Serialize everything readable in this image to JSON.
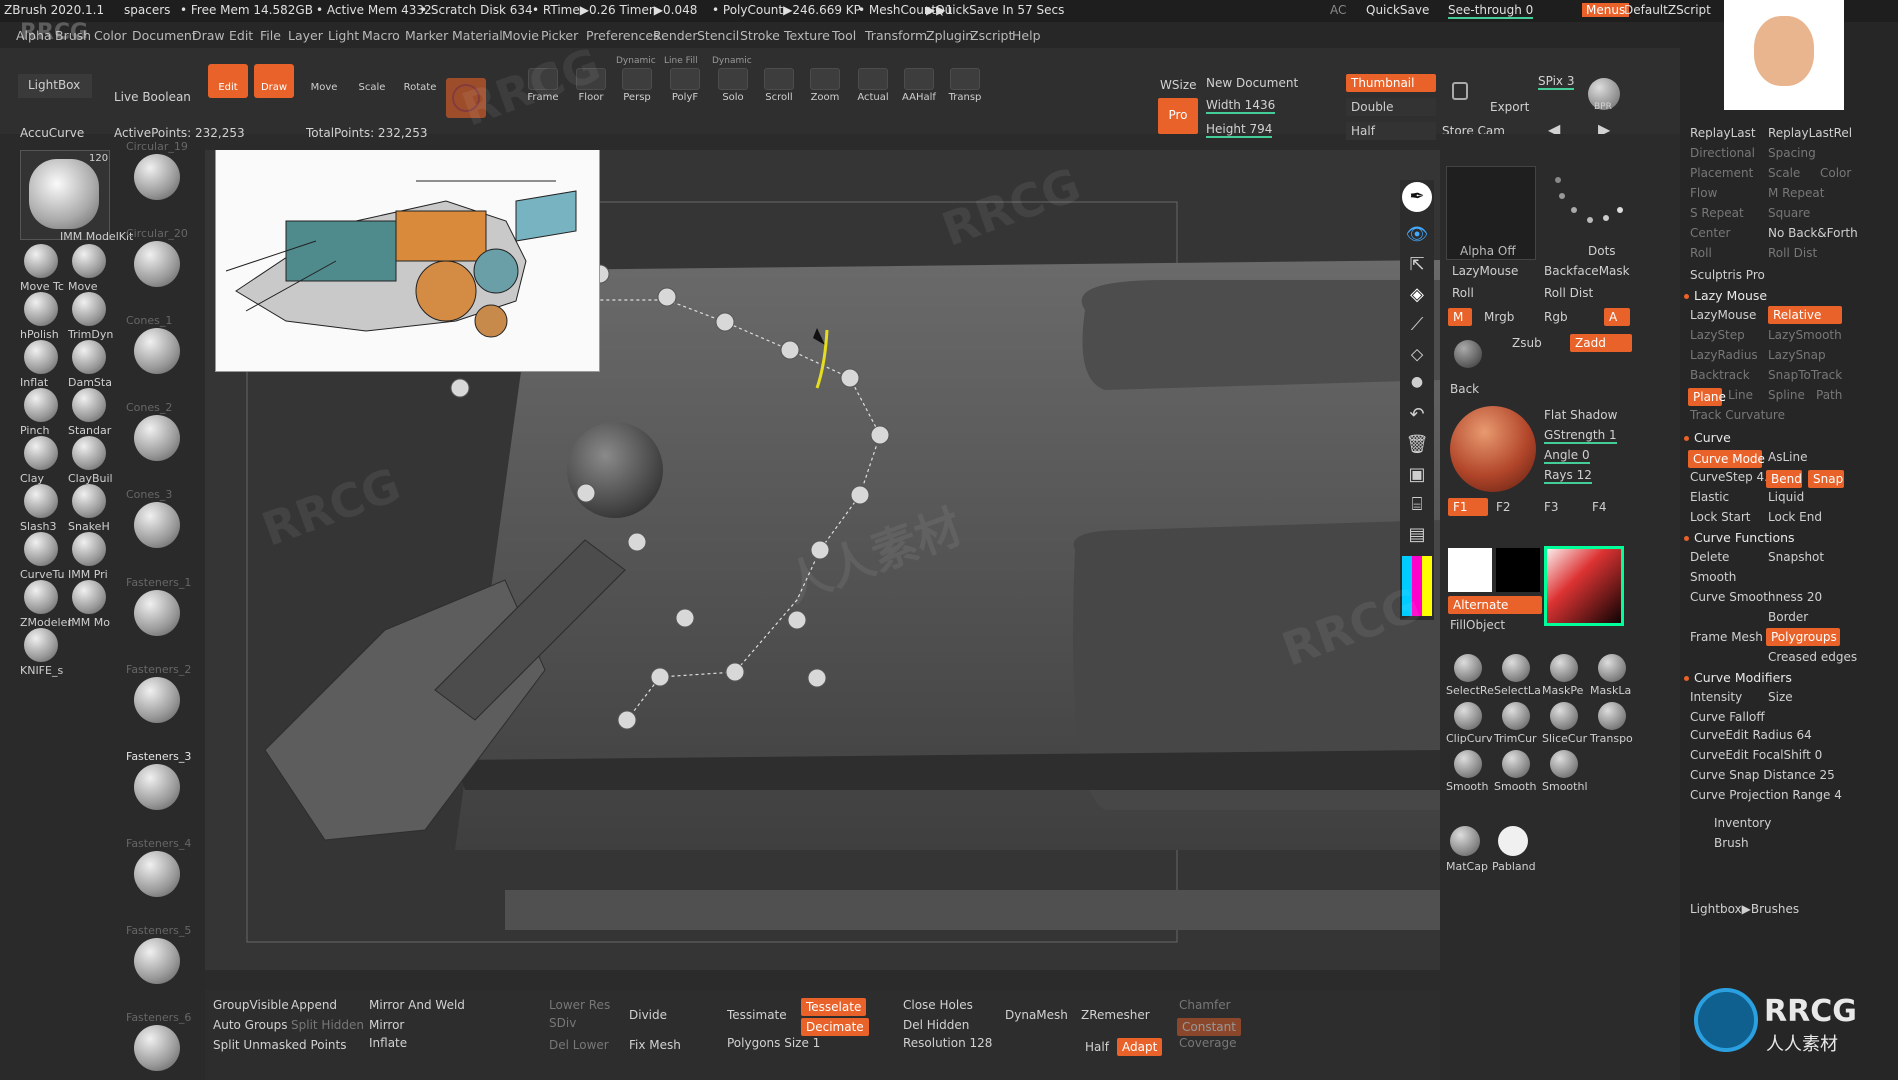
{
  "titlebar": {
    "app": "ZBrush 2020.1.1",
    "project": "spacers",
    "free_mem": "• Free Mem 14.582GB",
    "active_mem": "• Active Mem 4332",
    "scratch": "• Scratch Disk 634",
    "rtime": "• RTime▶0.26 Timer▶0.048",
    "polycount": "• PolyCount▶246.669 KP",
    "meshcount": "• MeshCount▶1",
    "quicksave_info": "▶QuickSave In 57 Secs",
    "ac": "AC",
    "quicksave": "QuickSave",
    "seethrough": "See-through 0",
    "menus": "Menus",
    "script": "DefaultZScript"
  },
  "menu": [
    "Alpha",
    "Brush",
    "Color",
    "Document",
    "Draw",
    "Edit",
    "File",
    "Layer",
    "Light",
    "Macro",
    "Marker",
    "Material",
    "Movie",
    "Picker",
    "Preferences",
    "Render",
    "Stencil",
    "Stroke",
    "Texture",
    "Tool",
    "Transform",
    "Zplugin",
    "Zscript",
    "Help"
  ],
  "shelf": {
    "lightbox": "LightBox",
    "live_boolean": "Live Boolean",
    "tools": [
      {
        "label": "Edit",
        "active": true
      },
      {
        "label": "Draw",
        "active": true
      },
      {
        "label": "Move",
        "active": false
      },
      {
        "label": "Scale",
        "active": false
      },
      {
        "label": "Rotate",
        "active": false
      }
    ],
    "nav": [
      "Frame",
      "Floor",
      "Persp",
      "PolyF",
      "Solo",
      "Scroll",
      "Zoom",
      "Actual",
      "AAHalf",
      "Transp"
    ],
    "nav_top": [
      "Dynamic",
      "Line Fill",
      "Dynamic"
    ],
    "wsize": "WSize",
    "pro": "Pro",
    "new_document": "New Document",
    "thumbnail": "Thumbnail",
    "width": "Width 1436",
    "height": "Height 794",
    "double": "Double",
    "half": "Half",
    "export": "Export",
    "store_cam": "Store Cam",
    "spix": "SPix 3",
    "bpr": "BPR"
  },
  "info": {
    "accucurve": "AccuCurve",
    "active_points": "ActivePoints: 232,253",
    "total_points": "TotalPoints: 232,253"
  },
  "brushes_left": [
    "IMM ModelKit",
    "Move Tc",
    "Move",
    "hPolish",
    "TrimDyn",
    "Inflat",
    "DamSta",
    "Pinch",
    "Standar",
    "Clay",
    "ClayBuil",
    "Slash3",
    "SnakeH",
    "CurveTu",
    "IMM Pri",
    "ZModeler",
    "IMM Mo",
    "KNIFE_s"
  ],
  "brushes_col2": [
    "Circular_19",
    "Circular_20",
    "Cones_1",
    "Cones_2",
    "Cones_3",
    "Fasteners_1",
    "Fasteners_2",
    "Fasteners_3",
    "Fasteners_4",
    "Fasteners_5",
    "Fasteners_6"
  ],
  "brush_badge": "120",
  "midpanel": {
    "alpha_off": "Alpha Off",
    "dots": "Dots",
    "lazymouse": "LazyMouse",
    "backfacemask": "BackfaceMask",
    "roll": "Roll",
    "roll_dist": "Roll Dist",
    "m": "M",
    "mrgb": "Mrgb",
    "rgb": "Rgb",
    "a": "A",
    "zsub": "Zsub",
    "zadd": "Zadd",
    "back": "Back",
    "flat_shadow": "Flat Shadow",
    "gstrength": "GStrength 1",
    "angle": "Angle 0",
    "rays": "Rays 12",
    "f1": "F1",
    "f2": "F2",
    "f3": "F3",
    "f4": "F4",
    "alternate": "Alternate",
    "fillobject": "FillObject",
    "sel": [
      "SelectRe",
      "SelectLa",
      "MaskPe",
      "MaskLa"
    ],
    "clip": [
      "ClipCurv",
      "TrimCur",
      "SliceCur",
      "Transpo"
    ],
    "smooth": [
      "Smooth",
      "Smooth",
      "Smoothl"
    ],
    "matcap": "MatCap",
    "pabland": "Pabland"
  },
  "rightpanel": {
    "replaylast": "ReplayLast",
    "replaylastrel": "ReplayLastRel",
    "directional": "Directional",
    "spacing": "Spacing",
    "placement": "Placement",
    "scale": "Scale",
    "color": "Color",
    "flow": "Flow",
    "m_repeat": "M Repeat",
    "s_repeat": "S Repeat",
    "square": "Square",
    "center": "Center",
    "no_backforth": "No Back&Forth",
    "roll": "Roll",
    "roll_dist": "Roll Dist",
    "sculptris_pro": "Sculptris Pro",
    "lazy_mouse_sec": "Lazy Mouse",
    "lazymouse": "LazyMouse",
    "relative": "Relative",
    "lazystep": "LazyStep",
    "lazysmooth": "LazySmooth",
    "lazyradius": "LazyRadius",
    "lazysnap": "LazySnap",
    "backtrack": "Backtrack",
    "snaptotrack": "SnapToTrack",
    "plane": "Plane",
    "line": "Line",
    "spline": "Spline",
    "path": "Path",
    "track_curvature": "Track Curvature",
    "curve_sec": "Curve",
    "curve_mode": "Curve Mode",
    "asline": "AsLine",
    "curvestep": "CurveStep 4.109",
    "bend": "Bend",
    "snap": "Snap",
    "elastic": "Elastic",
    "liquid": "Liquid",
    "lock_start": "Lock Start",
    "lock_end": "Lock End",
    "curve_functions": "Curve Functions",
    "delete": "Delete",
    "snapshot": "Snapshot",
    "smooth": "Smooth",
    "curve_smoothness": "Curve Smoothness 20",
    "border": "Border",
    "frame_mesh": "Frame Mesh",
    "polygroups": "Polygroups",
    "creased_edges": "Creased edges",
    "curve_modifiers": "Curve Modifiers",
    "intensity": "Intensity",
    "size": "Size",
    "curve_falloff": "Curve Falloff",
    "curveedit_radius": "CurveEdit Radius 64",
    "curveedit_focalshift": "CurveEdit FocalShift 0",
    "curve_snap_distance": "Curve Snap Distance 25",
    "curve_projection_range": "Curve Projection Range 4",
    "inventory": "Inventory",
    "brush": "Brush",
    "lightbox_brushes": "Lightbox▶Brushes"
  },
  "bottom": {
    "groupvisible": "GroupVisible",
    "append": "Append",
    "mirror_weld": "Mirror And Weld",
    "lower_res": "Lower Res",
    "divide": "Divide",
    "tessimate": "Tessimate",
    "tesselate": "Tesselate",
    "close_holes": "Close Holes",
    "dynamesh": "DynaMesh",
    "zremesher": "ZRemesher",
    "chamfer": "Chamfer",
    "auto_groups": "Auto Groups",
    "split_hidden": "Split Hidden",
    "mirror": "Mirror",
    "sdiv": "SDiv",
    "decimate": "Decimate",
    "del_hidden": "Del Hidden",
    "constant": "Constant",
    "split_unmasked": "Split Unmasked Points",
    "inflate": "Inflate",
    "del_lower": "Del Lower",
    "fix_mesh": "Fix Mesh",
    "polygons_size": "Polygons Size 1",
    "resolution": "Resolution 128",
    "half": "Half",
    "adapt": "Adapt",
    "coverage": "Coverage"
  },
  "watermark": "RRCG",
  "watermark_cn": "人人素材",
  "logo_text": "RRCG",
  "logo_sub": "人人素材",
  "accent": "#e8622a"
}
